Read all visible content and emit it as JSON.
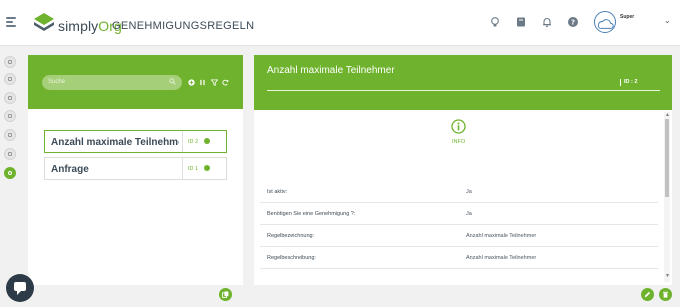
{
  "app": {
    "brand_first": "simply",
    "brand_second": "Org"
  },
  "page": {
    "title": "GENEHMIGUNGSREGELN"
  },
  "user": {
    "name": "Super"
  },
  "search": {
    "placeholder": "Suche"
  },
  "rules": [
    {
      "label": "Anzahl maximale Teilnehmer",
      "id": "ID 2",
      "selected": true
    },
    {
      "label": "Anfrage",
      "id": "ID 1",
      "selected": false
    }
  ],
  "detail": {
    "title": "Anzahl maximale Teilnehmer",
    "id_label": "ID : 2",
    "info_label": "INFO",
    "properties": [
      {
        "label": "Ist aktiv:",
        "value": "Ja"
      },
      {
        "label": "Benötigen Sie eine Genehmigung ?:",
        "value": "Ja"
      },
      {
        "label": "Regelbezeichnung:",
        "value": "Anzahl maximale Teilnehmer"
      },
      {
        "label": "Regelbeschreibung:",
        "value": "Anzahl maximale Teilnehmer"
      }
    ]
  },
  "colors": {
    "accent": "#6fb22d",
    "dark": "#2c3b47",
    "text": "#3d4a55"
  },
  "icons": {
    "topbar": [
      "lightbulb-icon",
      "book-icon",
      "bell-icon",
      "help-icon"
    ],
    "sidebar": [
      "home-icon",
      "chat-icon",
      "building-icon",
      "calendar-icon",
      "eye-icon",
      "document-icon",
      "rules-icon"
    ]
  }
}
